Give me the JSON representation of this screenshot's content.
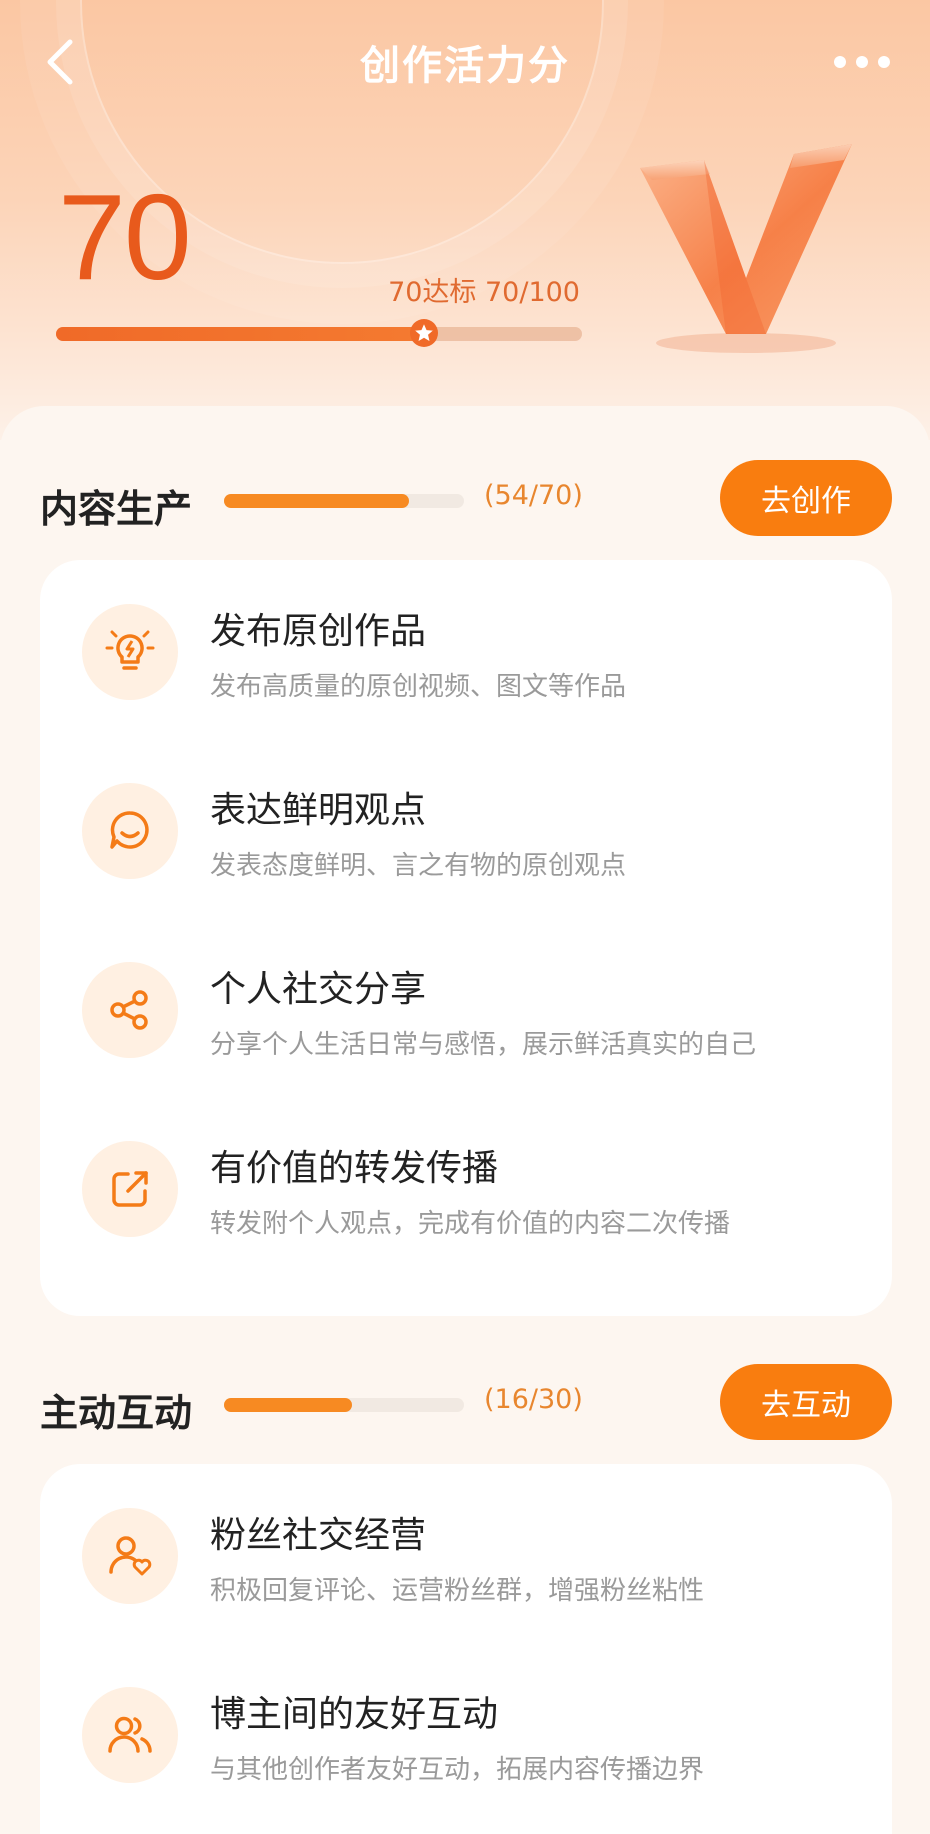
{
  "header": {
    "title": "创作活力分",
    "back_icon": "chevron-left-icon",
    "more_icon": "more-dots-icon"
  },
  "score": {
    "value": "70",
    "status_label": "70达标  70/100",
    "progress": 0.7
  },
  "sections": [
    {
      "title": "内容生产",
      "count": "(54/70)",
      "progress": 0.771,
      "button": "去创作",
      "items": [
        {
          "icon": "lightbulb-icon",
          "title": "发布原创作品",
          "desc": "发布高质量的原创视频、图文等作品"
        },
        {
          "icon": "chat-smile-icon",
          "title": "表达鲜明观点",
          "desc": "发表态度鲜明、言之有物的原创观点"
        },
        {
          "icon": "share-icon",
          "title": "个人社交分享",
          "desc": "分享个人生活日常与感悟，展示鲜活真实的自己"
        },
        {
          "icon": "forward-icon",
          "title": "有价值的转发传播",
          "desc": "转发附个人观点，完成有价值的内容二次传播"
        }
      ]
    },
    {
      "title": "主动互动",
      "count": "(16/30)",
      "progress": 0.533,
      "button": "去互动",
      "items": [
        {
          "icon": "user-heart-icon",
          "title": "粉丝社交经营",
          "desc": "积极回复评论、运营粉丝群，增强粉丝粘性"
        },
        {
          "icon": "users-icon",
          "title": "博主间的友好互动",
          "desc": "与其他创作者友好互动，拓展内容传播边界"
        }
      ]
    }
  ],
  "colors": {
    "accent": "#f97d0f",
    "score": "#e85a1c",
    "icon_bg": "#fff0e2"
  }
}
